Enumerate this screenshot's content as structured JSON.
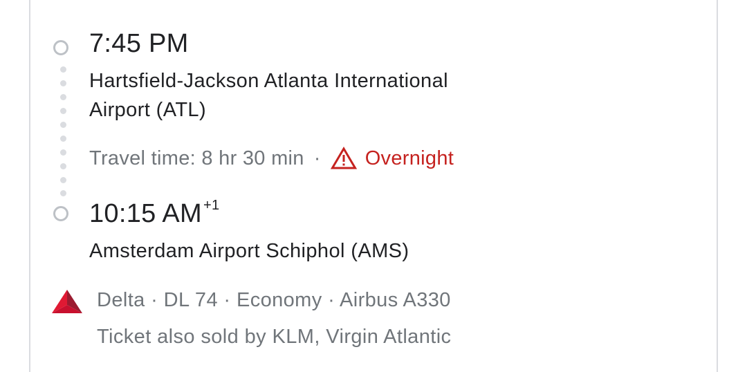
{
  "departure": {
    "time": "7:45 PM",
    "airport_line1": "Hartsfield-Jackson Atlanta International",
    "airport_line2": "Airport (ATL)"
  },
  "travel": {
    "time": "Travel time: 8 hr 30 min",
    "separator": "·",
    "warning": "Overnight",
    "warning_icon": "warning-triangle-icon",
    "warning_color": "#c5221f"
  },
  "arrival": {
    "time": "10:15 AM",
    "day_offset": "+1",
    "airport": "Amsterdam Airport Schiphol (AMS)"
  },
  "flight": {
    "airline_logo": "delta-logo",
    "details": "Delta · DL 74 · Economy · Airbus A330",
    "sold_by": "Ticket also sold by KLM, Virgin Atlantic"
  }
}
